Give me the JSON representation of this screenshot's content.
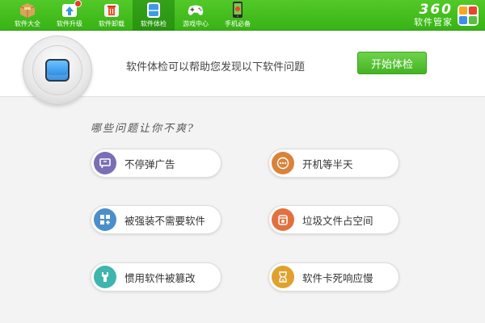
{
  "nav": {
    "items": [
      {
        "label": "软件大全",
        "icon": "software-box-icon"
      },
      {
        "label": "软件升级",
        "icon": "upgrade-icon"
      },
      {
        "label": "软件卸载",
        "icon": "uninstall-icon"
      },
      {
        "label": "软件体检",
        "icon": "checkup-icon"
      },
      {
        "label": "游戏中心",
        "icon": "gamepad-icon"
      },
      {
        "label": "手机必备",
        "icon": "phone-icon"
      }
    ],
    "active_index": 3
  },
  "brand": {
    "number": "360",
    "name": "软件管家",
    "colors": [
      "#f7a823",
      "#e8442f",
      "#3f8fe6",
      "#57c043"
    ]
  },
  "header": {
    "message": "软件体检可以帮助您发现以下软件问题",
    "start_button": "开始体检"
  },
  "question": "哪些问题让你不爽?",
  "issues": [
    {
      "label": "不停弹广告",
      "icon": "popup-ad-icon",
      "color": "#7a6fb5"
    },
    {
      "label": "开机等半天",
      "icon": "waiting-dots-icon",
      "color": "#d9833a"
    },
    {
      "label": "被强装不需要软件",
      "icon": "forced-install-icon",
      "color": "#4a8fc9"
    },
    {
      "label": "垃圾文件占空间",
      "icon": "trash-file-icon",
      "color": "#e2713f"
    },
    {
      "label": "惯用软件被篡改",
      "icon": "tampered-icon",
      "color": "#3eb6ad"
    },
    {
      "label": "软件卡死响应慢",
      "icon": "hourglass-icon",
      "color": "#e0a12e"
    }
  ],
  "colors": {
    "toolbar_green": "#3fb81c",
    "button_green": "#52c02f"
  }
}
